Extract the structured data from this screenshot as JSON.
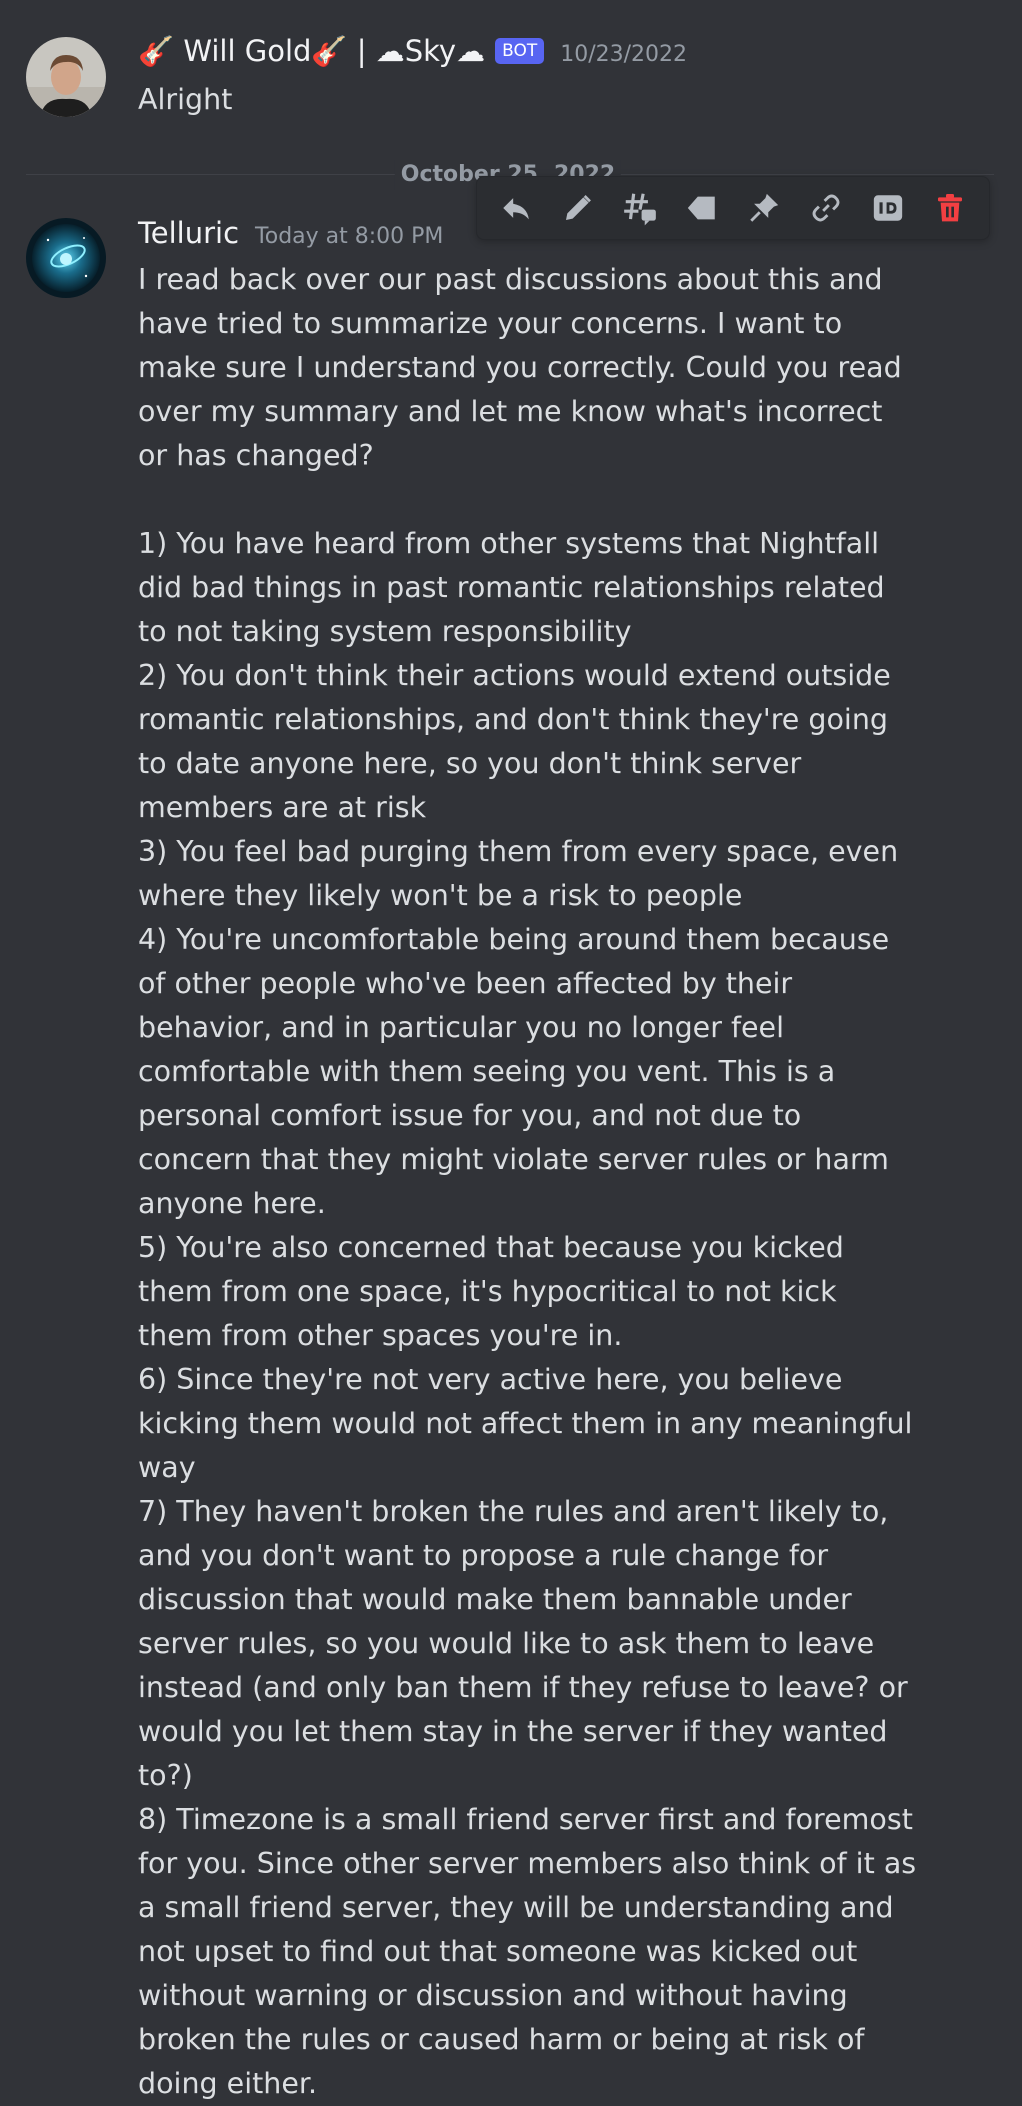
{
  "colors": {
    "background": "#313338",
    "bot_badge": "#5865f2",
    "delete_icon": "#f23f42",
    "toolbar_icon": "#b5bac1"
  },
  "messages": [
    {
      "author": "🎸 Will Gold🎸 | ☁Sky☁",
      "badge": "BOT",
      "timestamp": "10/23/2022",
      "content": "Alright",
      "avatar_icon": "person-photo"
    },
    {
      "author": "Telluric",
      "timestamp": "Today at 8:00 PM",
      "avatar_icon": "planet-nebula",
      "content": "I read back over our past discussions about this and have tried to summarize your concerns. I want to make sure I understand you correctly. Could you read over my summary and let me know what's incorrect or has changed?\n\n1) You have heard from other systems that Nightfall did bad things in past romantic relationships related to not taking system responsibility\n2) You don't think their actions would extend outside romantic relationships, and don't think they're going to date anyone here, so you don't think server members are at risk\n3) You feel bad purging them from every space, even where they likely won't be a risk to people\n4) You're uncomfortable being around them because of other people who've been affected by their behavior, and in particular you no longer feel comfortable with them seeing you vent. This is a personal comfort issue for you, and not due to concern that they might violate server rules or harm anyone here.\n5) You're also concerned that because you kicked them from one space, it's hypocritical to not kick them from other spaces you're in.\n6) Since they're not very active here, you believe kicking them would not affect them in any meaningful way\n7) They haven't broken the rules and aren't likely to, and you don't want to propose a rule change for discussion that would make them bannable under server rules, so you would like to ask them to leave instead (and only ban them if they refuse to leave? or would you let them stay in the server if they wanted to?)\n8) Timezone is a small friend server first and foremost for you. Since other server members also think of it as a small friend server, they will be understanding and not upset to find out that someone was kicked out without warning or discussion and without having broken the rules or caused harm or being at risk of doing either."
    }
  ],
  "divider": {
    "date": "October 25, 2022"
  },
  "toolbar": {
    "icons": [
      "reply-icon",
      "edit-icon",
      "create-thread-icon",
      "tag-icon",
      "pin-icon",
      "copy-link-icon",
      "copy-id-icon",
      "delete-icon"
    ]
  }
}
